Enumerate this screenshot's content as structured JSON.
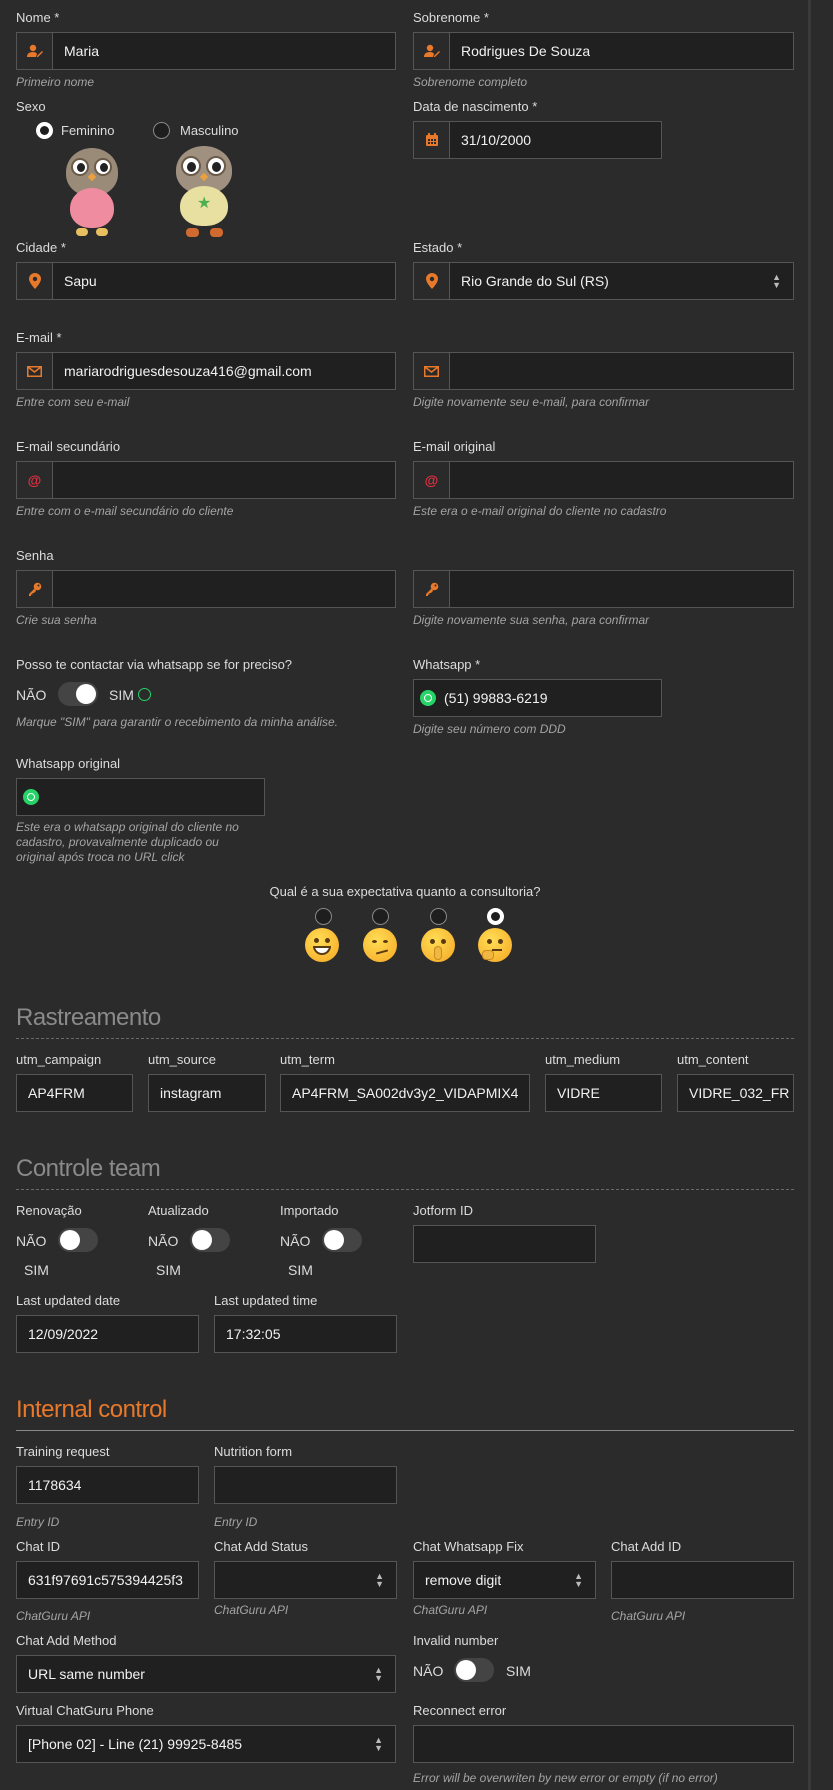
{
  "personal": {
    "nome": {
      "label": "Nome",
      "value": "Maria",
      "help": "Primeiro nome"
    },
    "sobrenome": {
      "label": "Sobrenome",
      "value": "Rodrigues De Souza",
      "help": "Sobrenome completo"
    },
    "sexo": {
      "label": "Sexo",
      "options": [
        "Feminino",
        "Masculino"
      ],
      "selected": "Feminino"
    },
    "nascimento": {
      "label": "Data de nascimento",
      "value": "31/10/2000"
    },
    "cidade": {
      "label": "Cidade",
      "value": "Sapu"
    },
    "estado": {
      "label": "Estado",
      "value": "Rio Grande do Sul (RS)"
    },
    "email": {
      "label": "E-mail",
      "value": "mariarodriguesdesouza416@gmail.com",
      "help": "Entre com seu e-mail",
      "confirm_value": "",
      "confirm_help": "Digite novamente seu e-mail, para confirmar"
    },
    "email_secundario": {
      "label": "E-mail secundário",
      "value": "",
      "help": "Entre com o e-mail secundário do cliente"
    },
    "email_original": {
      "label": "E-mail original",
      "value": "",
      "help": "Este era o e-mail original do cliente no cadastro"
    },
    "senha": {
      "label": "Senha",
      "value": "",
      "help": "Crie sua senha",
      "confirm_value": "",
      "confirm_help": "Digite novamente sua senha, para confirmar"
    },
    "contato": {
      "question": "Posso te contactar via whatsapp se for preciso?",
      "off": "NÃO",
      "on": "SIM",
      "state": "on",
      "help": "Marque \"SIM\" para garantir o recebimento da minha análise."
    },
    "whatsapp": {
      "label": "Whatsapp",
      "value": "(51) 99883-6219",
      "help": "Digite seu número com DDD"
    },
    "whatsapp_original": {
      "label": "Whatsapp original",
      "value": "",
      "help_lines": [
        "Este era o whatsapp original do cliente no",
        "cadastro, provavalmente duplicado ou",
        "original após troca no URL click"
      ]
    },
    "expectativa": {
      "question": "Qual é a sua expectativa quanto a consultoria?",
      "options": [
        "grinning",
        "smirking",
        "shushing",
        "thinking"
      ],
      "selected": 3
    }
  },
  "rastreamento": {
    "title": "Rastreamento",
    "fields": [
      {
        "label": "utm_campaign",
        "value": "AP4FRM"
      },
      {
        "label": "utm_source",
        "value": "instagram"
      },
      {
        "label": "utm_term",
        "value": "AP4FRM_SA002dv3y2_VIDAPMIX4"
      },
      {
        "label": "utm_medium",
        "value": "VIDRE"
      },
      {
        "label": "utm_content",
        "value": "VIDRE_032_FR"
      }
    ]
  },
  "controle": {
    "title": "Controle team",
    "toggles": [
      {
        "label": "Renovação",
        "off": "NÃO",
        "on": "SIM",
        "state": "off"
      },
      {
        "label": "Atualizado",
        "off": "NÃO",
        "on": "SIM",
        "state": "off"
      },
      {
        "label": "Importado",
        "off": "NÃO",
        "on": "SIM",
        "state": "off"
      }
    ],
    "jotform": {
      "label": "Jotform ID",
      "value": ""
    },
    "last_date": {
      "label": "Last updated date",
      "value": "12/09/2022"
    },
    "last_time": {
      "label": "Last updated time",
      "value": "17:32:05"
    }
  },
  "internal": {
    "title": "Internal control",
    "training": {
      "label": "Training request",
      "value": "1178634",
      "help": "Entry ID"
    },
    "nutrition": {
      "label": "Nutrition form",
      "value": "",
      "help": "Entry ID"
    },
    "chat_id": {
      "label": "Chat ID",
      "value": "631f97691c575394425f3",
      "help": "ChatGuru API"
    },
    "chat_add_status": {
      "label": "Chat Add Status",
      "value": "",
      "help": "ChatGuru API"
    },
    "chat_whatsapp_fix": {
      "label": "Chat Whatsapp Fix",
      "value": "remove digit",
      "help": "ChatGuru API"
    },
    "chat_add_id": {
      "label": "Chat Add ID",
      "value": "",
      "help": "ChatGuru API"
    },
    "chat_add_method": {
      "label": "Chat Add Method",
      "value": "URL same number"
    },
    "invalid_number": {
      "label": "Invalid number",
      "off": "NÃO",
      "on": "SIM",
      "state": "off"
    },
    "virtual_phone": {
      "label": "Virtual ChatGuru Phone",
      "value": "[Phone 02] - Line (21) 99925-8485"
    },
    "reconnect_error": {
      "label": "Reconnect error",
      "value": "",
      "help": "Error will be overwriten by new error or empty (if no error)"
    }
  },
  "colors": {
    "accent": "#e8782a",
    "background": "#2b2b2b",
    "input_bg": "#202020",
    "whatsapp": "#25d366"
  }
}
